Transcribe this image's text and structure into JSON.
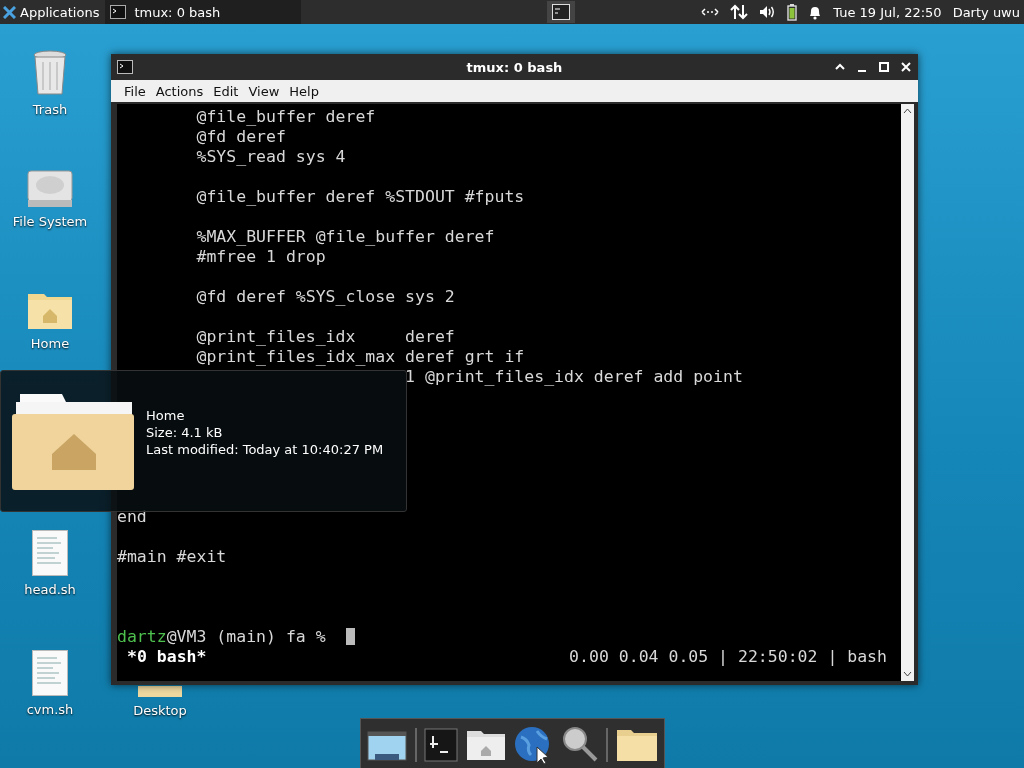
{
  "top_panel": {
    "menu_label": "Applications",
    "tasks": [
      {
        "title": "tmux: 0 bash",
        "selected": true
      }
    ],
    "clock": "Tue 19 Jul, 22:50",
    "user": "Darty uwu"
  },
  "desktop_icons": [
    {
      "label": "Trash",
      "kind": "trash"
    },
    {
      "label": "File System",
      "kind": "drive"
    },
    {
      "label": "Home",
      "kind": "home"
    },
    {
      "label": "head.sh",
      "kind": "script"
    },
    {
      "label": "cvm.sh",
      "kind": "script"
    },
    {
      "label": "Desktop",
      "kind": "folder"
    }
  ],
  "window": {
    "title": "tmux: 0 bash",
    "menu": [
      "File",
      "Actions",
      "Edit",
      "View",
      "Help"
    ],
    "lines": [
      {
        "kind": "code",
        "text": "        @file_buffer deref"
      },
      {
        "kind": "code",
        "text": "        @fd deref"
      },
      {
        "kind": "code",
        "text": "        %SYS_read sys 4"
      },
      {
        "kind": "blank"
      },
      {
        "kind": "code",
        "text": "        @file_buffer deref %STDOUT #fputs"
      },
      {
        "kind": "blank"
      },
      {
        "kind": "code",
        "text": "        %MAX_BUFFER @file_buffer deref"
      },
      {
        "kind": "code",
        "text": "        #mfree 1 drop"
      },
      {
        "kind": "blank"
      },
      {
        "kind": "code",
        "text": "        @fd deref %SYS_close sys 2"
      },
      {
        "kind": "blank"
      },
      {
        "kind": "code",
        "text": "        @print_files_idx     deref"
      },
      {
        "kind": "code",
        "text": "        @print_files_idx_max deref grt if"
      },
      {
        "kind": "code",
        "text": "                             1 @print_files_idx deref add point"
      },
      {
        "kind": "blank"
      },
      {
        "kind": "blank"
      },
      {
        "kind": "blank"
      },
      {
        "kind": "blank"
      },
      {
        "kind": "blank"
      },
      {
        "kind": "blank"
      },
      {
        "kind": "code",
        "text": "end"
      },
      {
        "kind": "blank"
      },
      {
        "kind": "code",
        "text": "#main #exit"
      },
      {
        "kind": "blank"
      },
      {
        "kind": "blank"
      },
      {
        "kind": "blank"
      }
    ],
    "prompt": {
      "user": "dartz",
      "rest": "@VM3 (main) fa %"
    },
    "status": {
      "left": "*0 bash*",
      "right": "0.00 0.04 0.05 | 22:50:02 | bash"
    }
  },
  "tooltip": {
    "name": "Home",
    "size": "Size: 4.1 kB",
    "modified": "Last modified: Today at 10:40:27 PM"
  },
  "dock": [
    {
      "kind": "desktop"
    },
    {
      "kind": "separator"
    },
    {
      "kind": "terminal"
    },
    {
      "kind": "home"
    },
    {
      "kind": "globe"
    },
    {
      "kind": "search"
    },
    {
      "kind": "separator"
    },
    {
      "kind": "folder"
    }
  ]
}
